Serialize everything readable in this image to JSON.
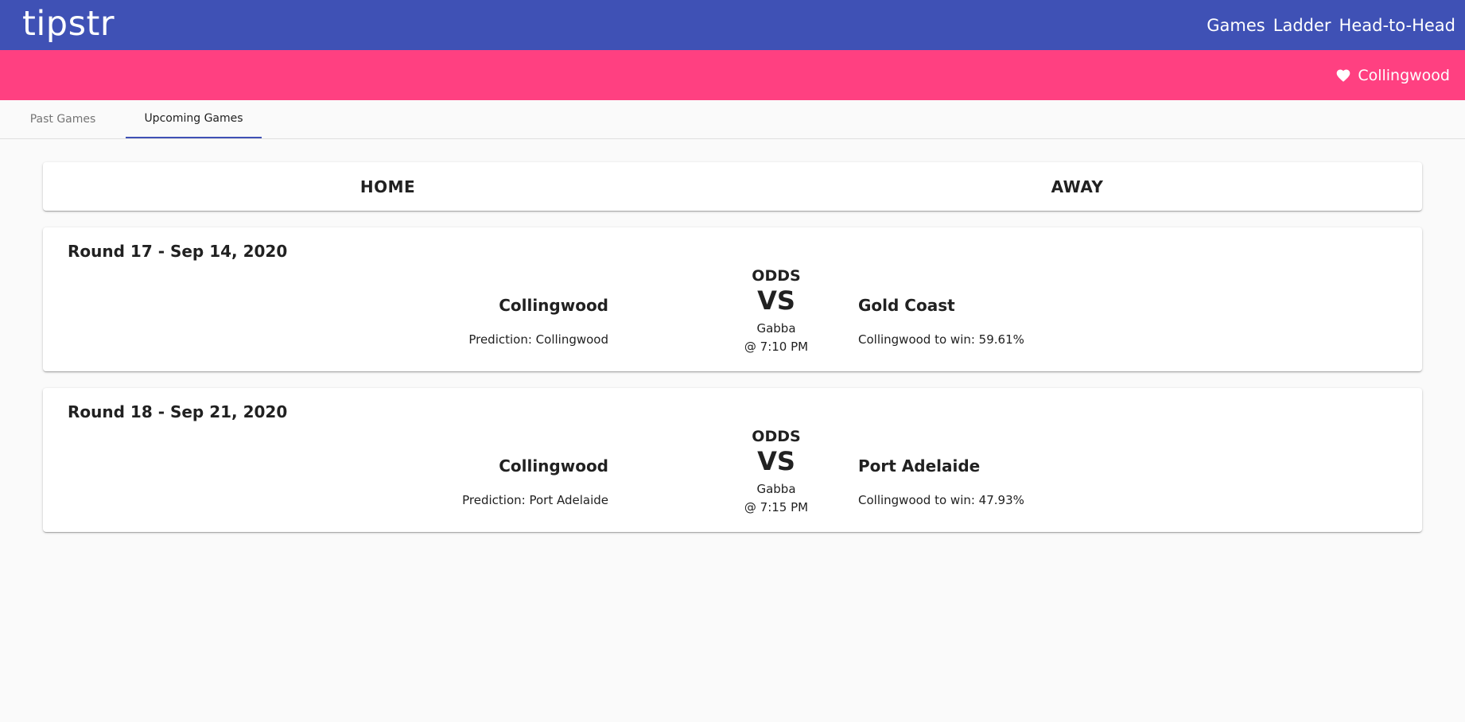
{
  "app": {
    "brand": "tipstr",
    "nav": [
      "Games",
      "Ladder",
      "Head-to-Head"
    ],
    "favourite_team": "Collingwood"
  },
  "tabs": [
    {
      "label": "Past Games",
      "active": false
    },
    {
      "label": "Upcoming Games",
      "active": true
    }
  ],
  "header": {
    "home": "HOME",
    "away": "AWAY"
  },
  "games": [
    {
      "round": "Round 17 - Sep 14, 2020",
      "home_team": "Collingwood",
      "prediction": "Prediction: Collingwood",
      "odds_label": "ODDS",
      "vs": "VS",
      "venue": "Gabba",
      "time": "@ 7:10 PM",
      "away_team": "Gold Coast",
      "win_chance": "Collingwood to win: 59.61%"
    },
    {
      "round": "Round 18 - Sep 21, 2020",
      "home_team": "Collingwood",
      "prediction": "Prediction: Port Adelaide",
      "odds_label": "ODDS",
      "vs": "VS",
      "venue": "Gabba",
      "time": "@ 7:15 PM",
      "away_team": "Port Adelaide",
      "win_chance": "Collingwood to win: 47.93%"
    }
  ],
  "colors": {
    "primary": "#3f51b5",
    "accent": "#ff4081",
    "background": "#fafafa"
  },
  "icons": {
    "favourite": "heart-icon"
  }
}
